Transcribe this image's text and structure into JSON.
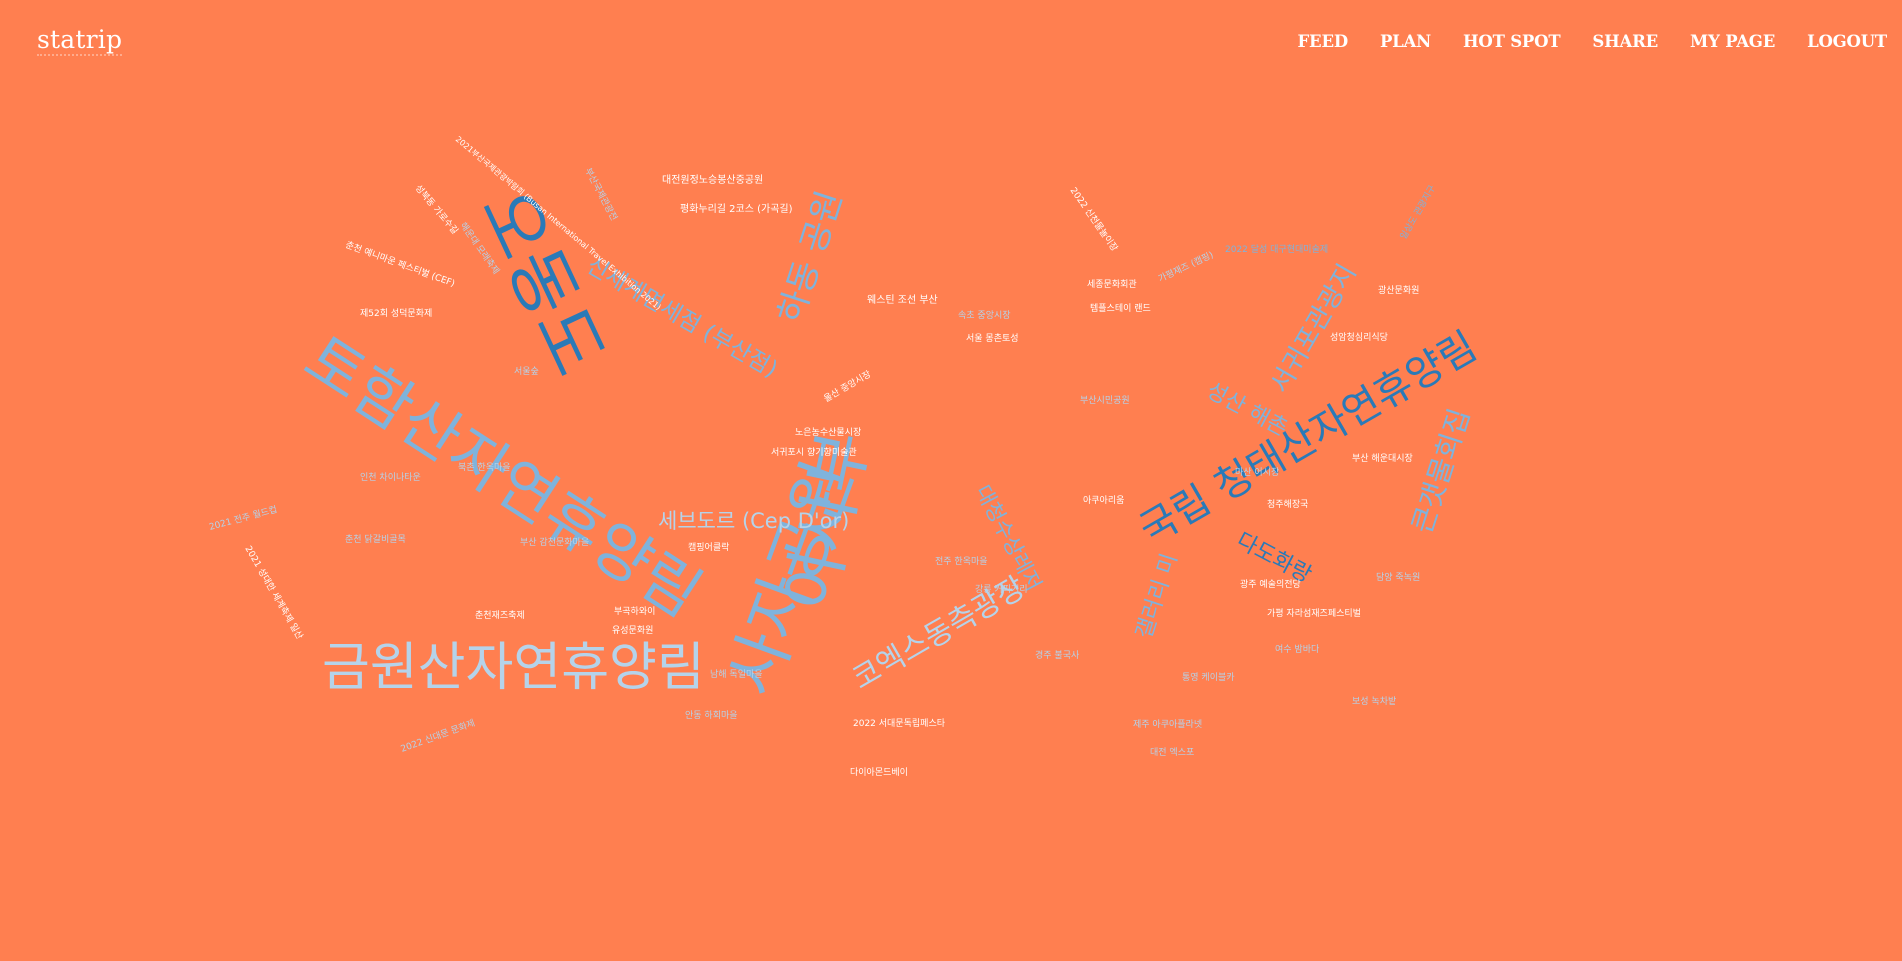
{
  "header": {
    "brand": "statrip",
    "nav": [
      "FEED",
      "PLAN",
      "HOT SPOT",
      "SHARE",
      "MY PAGE",
      "LOGOUT"
    ]
  },
  "colors": {
    "background": "#ff7f50",
    "text_light": "#ffffff",
    "cloud_dark_blue": "#2a7ab8",
    "cloud_mid_blue": "#7fb3dc",
    "cloud_pale_blue": "#b5d3ea"
  },
  "cloud": {
    "words": [
      "토함산자연휴양림",
      "오동도",
      "금원산자연휴양림",
      "이사부",
      "사자공원",
      "국립 청태산자연휴양림",
      "신세계면세점 (부산점)",
      "하동 공원",
      "코엑스동측광장",
      "서귀포관광지",
      "성산 해촌",
      "다도화랑",
      "대청수상레저",
      "세브도르 (Cep D'or)",
      "갤러리 미",
      "큰갯물회집",
      "2021부산국제관광박람회 (Busan International Travel Exhibition 2021)",
      "대전원정노승봉산중공원",
      "부산국제관광전",
      "일상도 관광지구",
      "평화누리길 2코스 (가곡길)",
      "웨스틴 조선 부산",
      "서울 몽촌토성",
      "광산문화원",
      "성북동 가로수길",
      "해운대 모래축제",
      "2022 달성 대구현대미술제",
      "2022 신천물놀이장",
      "춘천 예니마운 페스티벌 (CEF)",
      "제52회 성덕문화제",
      "아쿠아리움",
      "세종문화회관",
      "템플스테이 랜드",
      "부산 해운대시장",
      "성암청심리식당",
      "울산 중앙시장",
      "노은농수산물시장",
      "서귀포시 향기향미술관",
      "캠핑어클락",
      "유성문화원",
      "부곡하와이",
      "춘천재즈축제",
      "다이아몬드베이",
      "2022 서대문독립페스타",
      "청주해장국",
      "부산시민공원",
      "가평 자라섬재즈페스티벌",
      "광주 예술의전당",
      "2022 신대문 문화제",
      "2021 성대한 세계축제 일산",
      "2021 전주 월드컵",
      "가평재즈 (캠핑)",
      "제주 아쿠아플라넷",
      "대전 엑스포",
      "마산 어시장",
      "담양 죽녹원",
      "보성 녹차밭",
      "여수 밤바다",
      "통영 케이블카",
      "강릉 커피거리",
      "전주 한옥마을",
      "경주 불국사",
      "속초 중앙시장",
      "남해 독일마을",
      "안동 하회마을",
      "서울숲",
      "북촌 한옥마을",
      "인천 차이나타운",
      "춘천 닭갈비골목",
      "부산 감천문화마을"
    ]
  }
}
